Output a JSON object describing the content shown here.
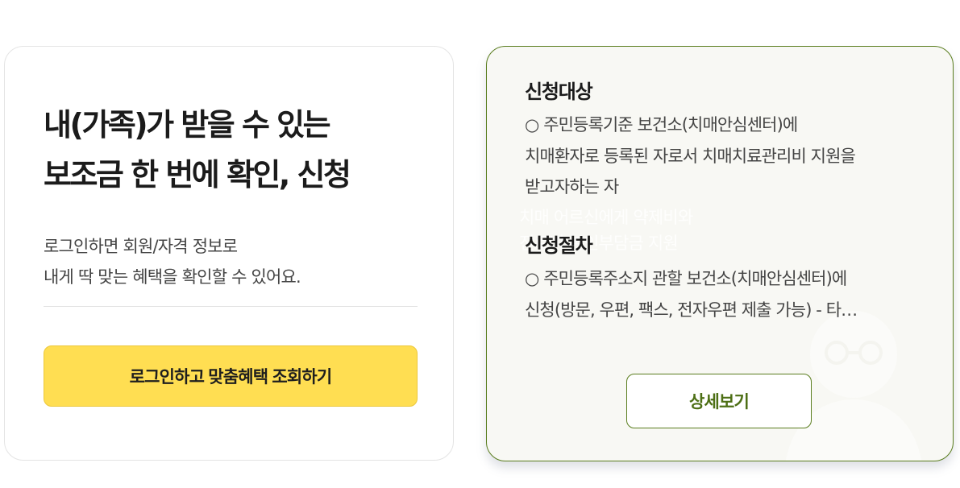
{
  "intro": {
    "headline_line1": "내(가족)가 받을 수 있는",
    "headline_line2": "보조금 한 번에 확인, 신청",
    "desc_line1": "로그인하면 회원/자격 정보로",
    "desc_line2": "내게 딱 맞는 혜택을 확인할 수 있어요.",
    "login_button_label": "로그인하고 맞춤혜택 조회하기"
  },
  "benefit": {
    "eligibility_title": "신청대상",
    "eligibility_lines": [
      "○ 주민등록기준 보건소(치매안심센터)에",
      "치매환자로 등록된 자로서 치매치료관리비 지원을",
      "받고자하는 자"
    ],
    "procedure_title": "신청절차",
    "procedure_lines": [
      "○ 주민등록주소지 관할 보건소(치매안심센터)에",
      "신청(방문, 우편, 팩스, 전자우편 제출 가능) - 타…"
    ],
    "ghost_lines": [
      "치매 어르신에게 약제비와",
      "진료비 본인부담금 지원"
    ],
    "detail_button_label": "상세보기"
  },
  "colors": {
    "accent_green": "#5a7d1e",
    "button_yellow": "#ffde52",
    "card_background": "#f8f8f4"
  },
  "icons": {
    "watermark": "elderly-person-illustration"
  }
}
